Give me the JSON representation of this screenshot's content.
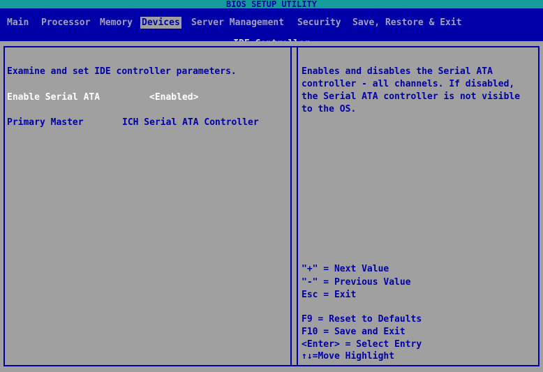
{
  "title": "BIOS SETUP UTILITY",
  "menu": [
    {
      "label": "Main",
      "active": false
    },
    {
      "label": "Processor",
      "active": false
    },
    {
      "label": "Memory",
      "active": false
    },
    {
      "label": "Devices",
      "active": true
    },
    {
      "label": "Server Management",
      "active": false
    },
    {
      "label": "Security",
      "active": false
    },
    {
      "label": "Save, Restore & Exit",
      "active": false
    }
  ],
  "subtitle": "IDE Controller",
  "left_panel": {
    "description": "Examine and set IDE controller parameters.",
    "items": [
      {
        "label": "Enable Serial ATA",
        "value": "<Enabled>"
      },
      {
        "label": "Primary Master",
        "value": "ICH Serial ATA Controller"
      }
    ]
  },
  "right_panel": {
    "help_text": "Enables and disables the Serial ATA\ncontroller - all channels. If disabled,\nthe Serial ATA controller is not visible\nto the OS.",
    "keys": [
      "\"+\" = Next Value",
      "\"-\" = Previous Value",
      "Esc = Exit",
      "F9 = Reset to Defaults",
      "F10 = Save and Exit",
      "<Enter> = Select Entry",
      "↑↓=Move Highlight"
    ]
  },
  "colors": {
    "title_bar": "#149c9c",
    "menu_bar": "#0000a8",
    "panel_background": "#a0a0a0",
    "text_blue": "#0000a8",
    "text_white": "#ffffff"
  }
}
